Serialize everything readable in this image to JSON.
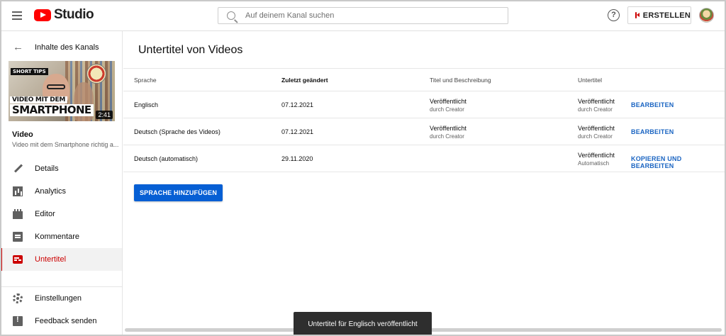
{
  "header": {
    "logo_text": "Studio",
    "search_placeholder": "Auf deinem Kanal suchen",
    "help_symbol": "?",
    "create_label": "ERSTELLEN"
  },
  "sidebar": {
    "back_label": "Inhalte des Kanals",
    "thumbnail": {
      "tag": "SHORT TIPS",
      "line1": "VIDEO MIT DEM",
      "line2": "SMARTPHONE",
      "duration": "2:41"
    },
    "video_title": "Video",
    "video_subtitle": "Video mit dem Smartphone richtig a...",
    "items": [
      {
        "label": "Details",
        "icon": "pencil-icon",
        "active": false
      },
      {
        "label": "Analytics",
        "icon": "analytics-icon",
        "active": false
      },
      {
        "label": "Editor",
        "icon": "film-icon",
        "active": false
      },
      {
        "label": "Kommentare",
        "icon": "comment-icon",
        "active": false
      },
      {
        "label": "Untertitel",
        "icon": "subtitles-icon",
        "active": true
      }
    ],
    "bottom_items": [
      {
        "label": "Einstellungen",
        "icon": "gear-icon"
      },
      {
        "label": "Feedback senden",
        "icon": "feedback-icon"
      }
    ]
  },
  "main": {
    "title": "Untertitel von Videos",
    "columns": [
      "Sprache",
      "Zuletzt geändert",
      "Titel und Beschreibung",
      "Untertitel"
    ],
    "rows": [
      {
        "language": "Englisch",
        "modified": "07.12.2021",
        "title_status": "Veröffentlicht",
        "title_by": "durch Creator",
        "sub_status": "Veröffentlicht",
        "sub_by": "durch Creator",
        "action": "BEARBEITEN"
      },
      {
        "language": "Deutsch (Sprache des Videos)",
        "modified": "07.12.2021",
        "title_status": "Veröffentlicht",
        "title_by": "durch Creator",
        "sub_status": "Veröffentlicht",
        "sub_by": "durch Creator",
        "action": "BEARBEITEN"
      },
      {
        "language": "Deutsch (automatisch)",
        "modified": "29.11.2020",
        "title_status": "",
        "title_by": "",
        "sub_status": "Veröffentlicht",
        "sub_by": "Automatisch",
        "action": "KOPIEREN UND BEARBEITEN"
      }
    ],
    "add_language_label": "SPRACHE HINZUFÜGEN"
  },
  "toast": {
    "message": "Untertitel für Englisch veröffentlicht"
  },
  "colors": {
    "accent_red": "#cc0000",
    "link_blue": "#1a64c2",
    "button_blue": "#065fd4"
  }
}
